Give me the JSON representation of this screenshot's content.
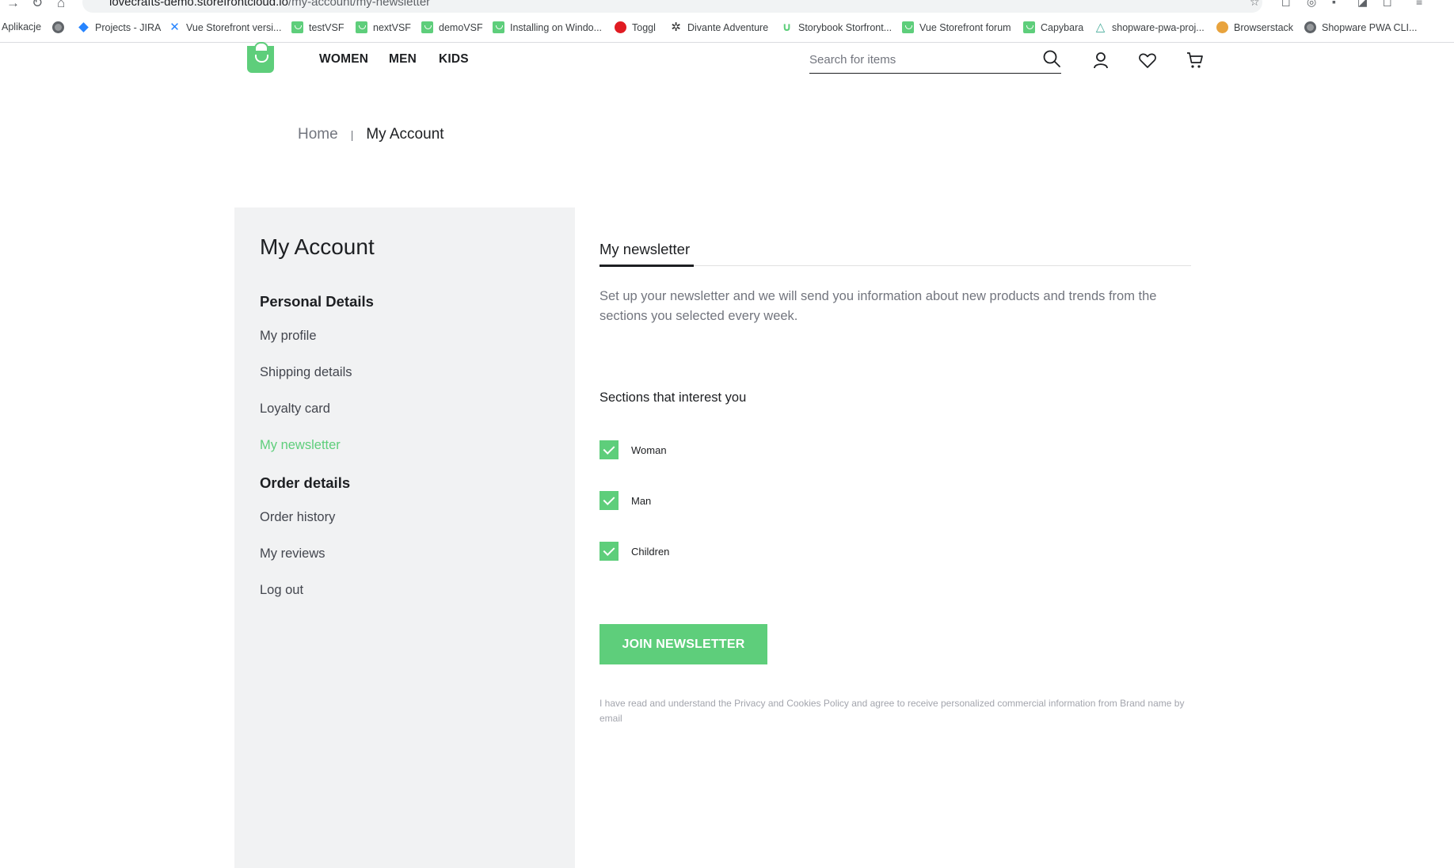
{
  "browser": {
    "url_host": "lovecrafts-demo.storefrontcloud.io",
    "url_path": "/my-account/my-newsletter",
    "bookmarks": [
      {
        "label": "Aplikacje",
        "icon": "apps-icon"
      },
      {
        "label": "",
        "icon": "globe-icon"
      },
      {
        "label": "Projects - JIRA",
        "icon": "jira-icon"
      },
      {
        "label": "Vue Storefront versi...",
        "icon": "vsf-x-icon"
      },
      {
        "label": "testVSF",
        "icon": "vsf-icon"
      },
      {
        "label": "nextVSF",
        "icon": "vsf-icon"
      },
      {
        "label": "demoVSF",
        "icon": "vsf-icon"
      },
      {
        "label": "Installing on Windo...",
        "icon": "vsf-icon"
      },
      {
        "label": "Toggl",
        "icon": "toggl-icon"
      },
      {
        "label": "Divante Adventure",
        "icon": "divante-icon"
      },
      {
        "label": "Storybook Storfront...",
        "icon": "storybook-icon"
      },
      {
        "label": "Vue Storefront forum",
        "icon": "vsf-icon"
      },
      {
        "label": "Capybara",
        "icon": "vsf-icon"
      },
      {
        "label": "shopware-pwa-proj...",
        "icon": "shopware-icon"
      },
      {
        "label": "Browserstack",
        "icon": "browserstack-icon"
      },
      {
        "label": "Shopware PWA CLI...",
        "icon": "globe-icon"
      }
    ]
  },
  "header": {
    "nav": [
      "WOMEN",
      "MEN",
      "KIDS"
    ],
    "search_placeholder": "Search for items"
  },
  "breadcrumb": {
    "home": "Home",
    "separator": "|",
    "current": "My Account"
  },
  "sidebar": {
    "title": "My Account",
    "personal_heading": "Personal Details",
    "personal_links": [
      "My profile",
      "Shipping details",
      "Loyalty card",
      "My newsletter"
    ],
    "order_heading": "Order details",
    "order_links": [
      "Order history",
      "My reviews",
      "Log out"
    ],
    "active": "My newsletter"
  },
  "content": {
    "tab": "My newsletter",
    "intro": "Set up your newsletter and we will send you information about new products and trends from the sections you selected every week.",
    "sections_title": "Sections that interest you",
    "sections": [
      {
        "label": "Woman",
        "checked": true
      },
      {
        "label": "Man",
        "checked": true
      },
      {
        "label": "Children",
        "checked": true
      }
    ],
    "button": "JOIN NEWSLETTER",
    "legal_prefix": "I have read and understand the",
    "legal_privacy": "Privacy",
    "legal_and": "and",
    "legal_cookies": "Cookies Policy",
    "legal_suffix": "and agree to receive personalized commercial information from Brand name by email"
  },
  "colors": {
    "primary": "#5ece7b",
    "text": "#1d1f22",
    "muted": "#72757e",
    "sidebar_bg": "#f1f2f3"
  }
}
